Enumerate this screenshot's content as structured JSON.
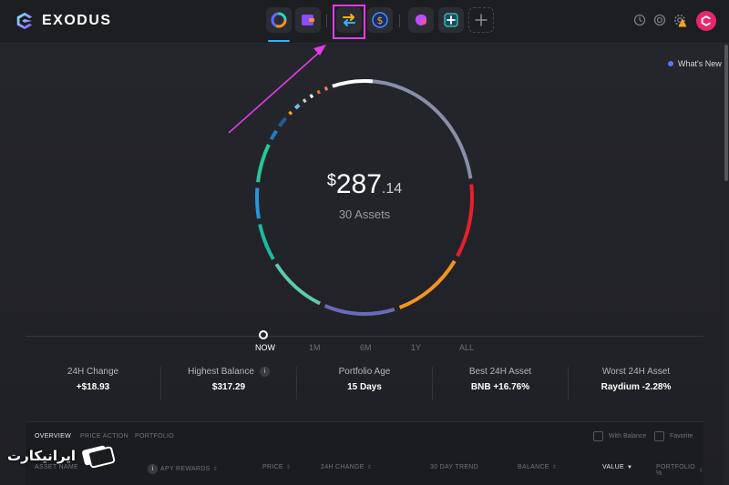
{
  "app": {
    "name": "EXODUS"
  },
  "nav": {
    "items": [
      {
        "name": "portfolio",
        "icon": "portfolio-ring-icon"
      },
      {
        "name": "wallet",
        "icon": "wallet-icon"
      },
      {
        "name": "exchange",
        "icon": "exchange-arrows-icon"
      },
      {
        "name": "earn",
        "icon": "dollar-coin-icon"
      },
      {
        "name": "apps",
        "icon": "app-blob-icon"
      },
      {
        "name": "add-app",
        "icon": "add-app-icon"
      },
      {
        "name": "add-more",
        "icon": "plus-icon"
      }
    ],
    "active": "portfolio",
    "highlighted": "exchange"
  },
  "header_icons": [
    "history-icon",
    "restore-icon",
    "settings-gear-icon",
    "warning-icon",
    "profile-avatar-icon"
  ],
  "whats_new": "What's New",
  "portfolio": {
    "currency": "$",
    "balance_int": "287",
    "balance_dec": ".14",
    "assets": "30 Assets",
    "ring_segments": [
      {
        "fraction": 0.228,
        "color": "#8a8fa8"
      },
      {
        "fraction": 0.11,
        "color": "#e8202c"
      },
      {
        "fraction": 0.113,
        "color": "#f5941e"
      },
      {
        "fraction": 0.113,
        "color": "#6b6ab8"
      },
      {
        "fraction": 0.093,
        "color": "#5ec9b0"
      },
      {
        "fraction": 0.06,
        "color": "#1bb9a0"
      },
      {
        "fraction": 0.05,
        "color": "#2b95d6"
      },
      {
        "fraction": 0.062,
        "color": "#27c79a"
      },
      {
        "fraction": 0.022,
        "color": "#1f7bc4"
      },
      {
        "fraction": 0.022,
        "color": "#245c8f"
      },
      {
        "fraction": 0.012,
        "color": "#f5a623"
      },
      {
        "fraction": 0.015,
        "color": "#69c0ec"
      },
      {
        "fraction": 0.012,
        "color": "#c6c9d6"
      },
      {
        "fraction": 0.012,
        "color": "#ffffff"
      },
      {
        "fraction": 0.012,
        "color": "#f46b35"
      },
      {
        "fraction": 0.012,
        "color": "#ff7a6a"
      },
      {
        "fraction": 0.068,
        "color": "#ffffff"
      }
    ]
  },
  "ranges": [
    {
      "label": "NOW",
      "active": true
    },
    {
      "label": "1M",
      "active": false
    },
    {
      "label": "6M",
      "active": false
    },
    {
      "label": "1Y",
      "active": false
    },
    {
      "label": "ALL",
      "active": false
    }
  ],
  "stats": [
    {
      "label": "24H Change",
      "value": "+$18.93"
    },
    {
      "label": "Highest Balance",
      "value": "$317.29",
      "info": true
    },
    {
      "label": "Portfolio Age",
      "value": "15 Days"
    },
    {
      "label": "Best 24H Asset",
      "value": "BNB +16.76%"
    },
    {
      "label": "Worst 24H Asset",
      "value": "Raydium -2.28%"
    }
  ],
  "info_glyph": "i",
  "panel": {
    "tabs": [
      "OVERVIEW",
      "PRICE ACTION",
      "PORTFOLIO"
    ],
    "active_tab": "OVERVIEW",
    "filters": [
      "With Balance",
      "Favorite"
    ],
    "columns": [
      "ASSET NAME",
      "APY REWARDS",
      "PRICE",
      "24H CHANGE",
      "30 DAY TREND",
      "BALANCE",
      "VALUE",
      "PORTFOLIO %"
    ],
    "sorted_column": "VALUE"
  },
  "watermark": {
    "text": "ایرانیکارت"
  }
}
